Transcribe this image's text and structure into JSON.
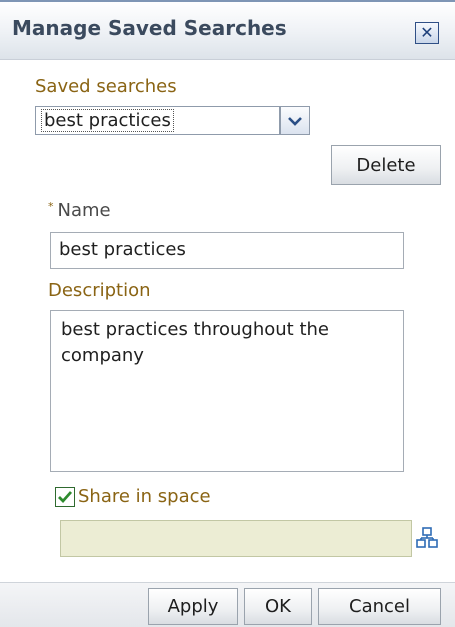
{
  "dialog": {
    "title": "Manage Saved Searches",
    "close_symbol": "✕"
  },
  "saved_searches": {
    "label": "Saved searches",
    "selected": "best practices"
  },
  "buttons": {
    "delete": "Delete",
    "apply": "Apply",
    "ok": "OK",
    "cancel": "Cancel"
  },
  "name": {
    "required_marker": "*",
    "label": "Name",
    "value": "best practices"
  },
  "description": {
    "label": "Description",
    "value": "best practices throughout the company"
  },
  "share": {
    "label": "Share in space",
    "checked": true,
    "space_value": ""
  },
  "icons": {
    "close": "close-icon",
    "dropdown": "chevron-down-icon",
    "checkbox": "checkmark-icon",
    "space_picker": "hierarchy-picker-icon"
  },
  "colors": {
    "label_text": "#8a6414",
    "title_text": "#3b4a5e",
    "checkbox_check": "#2e8b2e",
    "space_field_bg": "#ecedd4"
  }
}
